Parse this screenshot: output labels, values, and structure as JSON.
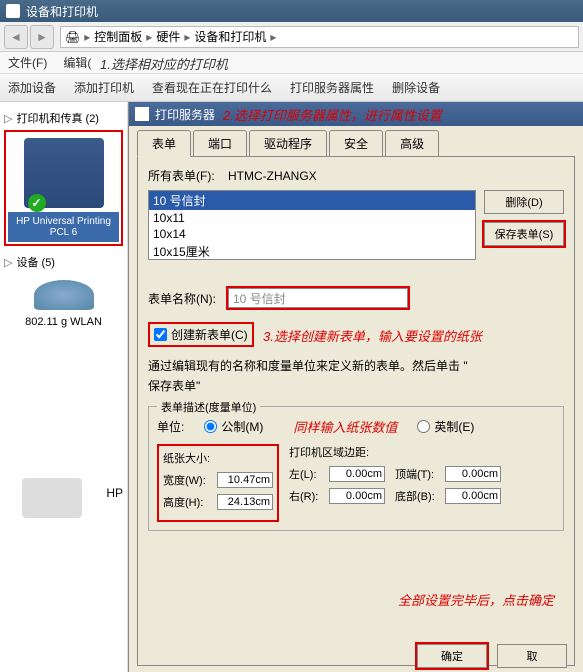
{
  "window": {
    "title": "设备和打印机"
  },
  "breadcrumb": {
    "p1": "控制面板",
    "p2": "硬件",
    "p3": "设备和打印机"
  },
  "menubar": {
    "file": "文件(F)",
    "edit": "编辑("
  },
  "toolbar": {
    "add_device": "添加设备",
    "add_printer": "添加打印机",
    "view_printing": "查看现在正在打印什么",
    "server_props": "打印服务器属性",
    "remove": "删除设备"
  },
  "sidebar": {
    "printers_header": "打印机和传真 (2)",
    "printer_name": "HP Universal Printing PCL 6",
    "devices_header": "设备 (5)",
    "wlan_name": "802.11 g WLAN",
    "bottom_label": "HP"
  },
  "dialog": {
    "title": "打印服务器",
    "tabs": {
      "forms": "表单",
      "ports": "端口",
      "drivers": "驱动程序",
      "security": "安全",
      "advanced": "高级"
    },
    "all_forms_label": "所有表单(F):",
    "server_name": "HTMC-ZHANGX",
    "form_items": [
      "10 号信封",
      "10x11",
      "10x14",
      "10x15厘米"
    ],
    "delete_btn": "删除(D)",
    "save_btn": "保存表单(S)",
    "name_label": "表单名称(N):",
    "name_value": "10 号信封",
    "create_new": "创建新表单(C)",
    "desc_line1": "通过编辑现有的名称和度量单位来定义新的表单。然后单击 \"",
    "desc_line2": "保存表单\"",
    "group_title": "表单描述(度量单位)",
    "unit_label": "单位:",
    "metric": "公制(M)",
    "english": "英制(E)",
    "paper_size": "纸张大小:",
    "margins": "打印机区域边距:",
    "width": "宽度(W):",
    "width_v": "10.47cm",
    "height": "高度(H):",
    "height_v": "24.13cm",
    "left": "左(L):",
    "left_v": "0.00cm",
    "right": "右(R):",
    "right_v": "0.00cm",
    "top": "顶端(T):",
    "top_v": "0.00cm",
    "bottom": "底部(B):",
    "bottom_v": "0.00cm",
    "ok": "确定",
    "cancel": "取"
  },
  "annotations": {
    "a1": "1.选择相对应的打印机",
    "a2": "2.选择打印服务器属性，进行属性设置",
    "a3": "3.选择创建新表单，输入要设置的纸张",
    "a4": "同样输入纸张数值",
    "a5": "全部设置完毕后，点击确定"
  }
}
